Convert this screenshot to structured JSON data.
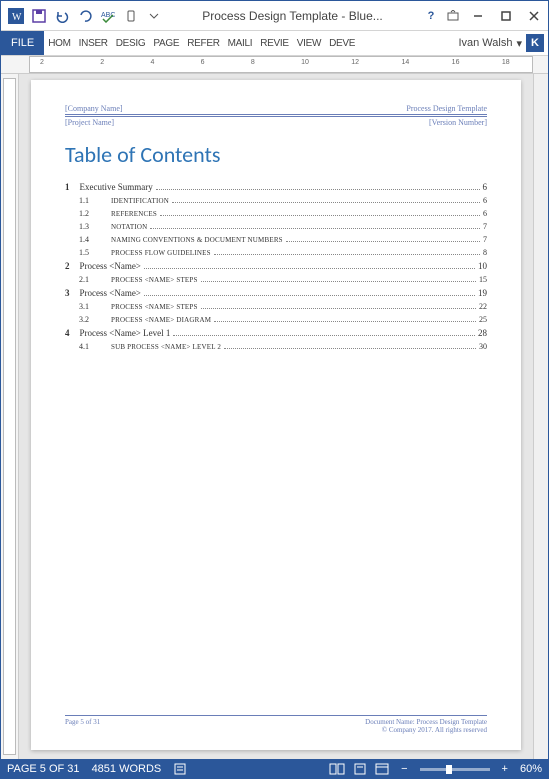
{
  "window": {
    "title": "Process Design Template - Blue..."
  },
  "ribbon": {
    "fileTab": "FILE",
    "tabs": [
      "HOM",
      "INSER",
      "DESIG",
      "PAGE",
      "REFER",
      "MAILI",
      "REVIE",
      "VIEW",
      "DEVE"
    ],
    "userName": "Ivan Walsh",
    "userInitial": "K"
  },
  "ruler": {
    "hticks": [
      "2",
      "",
      "2",
      "4",
      "6",
      "8",
      "10",
      "12",
      "14",
      "16",
      "18"
    ]
  },
  "doc": {
    "headerLeft1": "[Company Name]",
    "headerRight1": "Process Design Template",
    "headerLeft2": "[Project Name]",
    "headerRight2": "[Version Number]",
    "tocTitle": "Table of Contents",
    "toc": [
      {
        "lvl": 1,
        "num": "1",
        "label": "Executive Summary",
        "page": "6"
      },
      {
        "lvl": 2,
        "num": "1.1",
        "label": "Identification",
        "page": "6"
      },
      {
        "lvl": 2,
        "num": "1.2",
        "label": "References",
        "page": "6"
      },
      {
        "lvl": 2,
        "num": "1.3",
        "label": "Notation",
        "page": "7"
      },
      {
        "lvl": 2,
        "num": "1.4",
        "label": "Naming Conventions & Document Numbers",
        "page": "7"
      },
      {
        "lvl": 2,
        "num": "1.5",
        "label": "Process Flow Guidelines",
        "page": "8"
      },
      {
        "lvl": 1,
        "num": "2",
        "label": "Process <Name>",
        "page": "10"
      },
      {
        "lvl": 2,
        "num": "2.1",
        "label": "Process <Name> Steps",
        "page": "15"
      },
      {
        "lvl": 1,
        "num": "3",
        "label": "Process <Name>",
        "page": "19"
      },
      {
        "lvl": 2,
        "num": "3.1",
        "label": "Process <Name> Steps",
        "page": "22"
      },
      {
        "lvl": 2,
        "num": "3.2",
        "label": "Process <Name> Diagram",
        "page": "25"
      },
      {
        "lvl": 1,
        "num": "4",
        "label": "Process <Name> Level 1",
        "page": "28"
      },
      {
        "lvl": 2,
        "num": "4.1",
        "label": "Sub Process <Name> Level 2",
        "page": "30"
      }
    ],
    "footerLeft": "Page 5 of 31",
    "footerRight1": "Document Name: Process Design Template",
    "footerRight2": "© Company 2017. All rights reserved"
  },
  "status": {
    "pageInfo": "PAGE 5 OF 31",
    "words": "4851 WORDS",
    "zoom": "60%"
  }
}
